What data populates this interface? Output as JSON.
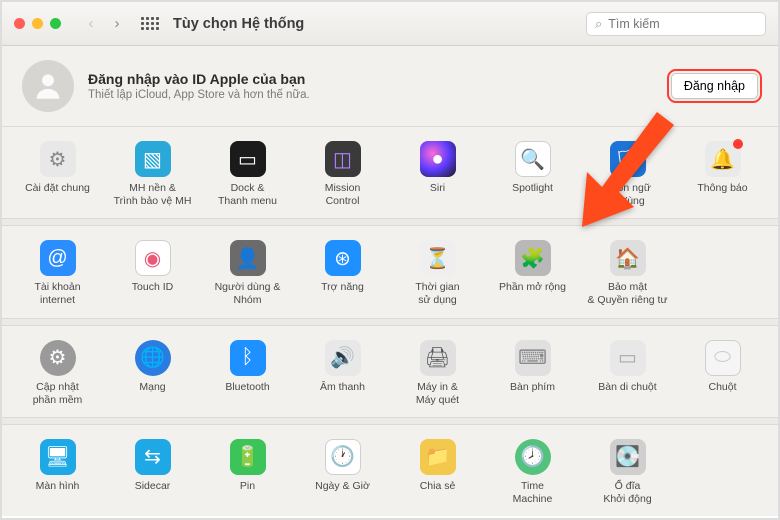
{
  "toolbar": {
    "title": "Tùy chọn Hệ thống",
    "search_placeholder": "Tìm kiếm"
  },
  "signin": {
    "heading": "Đăng nhập vào ID Apple của bạn",
    "sub": "Thiết lập iCloud, App Store và hơn thế nữa.",
    "button": "Đăng nhập"
  },
  "rows": [
    [
      {
        "id": "general",
        "label": "Cài đặt chung",
        "bg": "#e8e8e8",
        "glyph": "⚙",
        "fg": "#888"
      },
      {
        "id": "desktop",
        "label": "MH nền &\nTrình bảo vệ MH",
        "bg": "#2aa8d8",
        "glyph": "▧"
      },
      {
        "id": "dock",
        "label": "Dock &\nThanh menu",
        "bg": "#1b1b1b",
        "glyph": "▭"
      },
      {
        "id": "mission",
        "label": "Mission\nControl",
        "bg": "#3a3a3a",
        "glyph": "◫",
        "fg": "#b080ff"
      },
      {
        "id": "siri",
        "label": "Siri",
        "bg": "radial",
        "glyph": "●"
      },
      {
        "id": "spotlight",
        "label": "Spotlight",
        "bg": "#fff",
        "glyph": "🔍",
        "fg": "#4a4a4a",
        "border": true
      },
      {
        "id": "language",
        "label": "Ngôn ngữ\n& Vùng",
        "bg": "#1e74d6",
        "glyph": "🏳"
      },
      {
        "id": "notifications",
        "label": "Thông báo",
        "bg": "#eaeaea",
        "glyph": "🔔",
        "fg": "#555",
        "badge": true
      }
    ],
    [
      {
        "id": "internet",
        "label": "Tài khoản\ninternet",
        "bg": "#2b8eff",
        "glyph": "@"
      },
      {
        "id": "touchid",
        "label": "Touch ID",
        "bg": "#fff",
        "glyph": "◉",
        "fg": "#e85b78",
        "border": true
      },
      {
        "id": "users",
        "label": "Người dùng &\nNhóm",
        "bg": "#6b6b6b",
        "glyph": "👤"
      },
      {
        "id": "accessibility",
        "label": "Trợ năng",
        "bg": "#1e90ff",
        "glyph": "⊛"
      },
      {
        "id": "screentime",
        "label": "Thời gian\nsử dụng",
        "bg": "#efefef",
        "glyph": "⏳",
        "fg": "#6a5acd"
      },
      {
        "id": "extensions",
        "label": "Phần mở rộng",
        "bg": "#b8b8b8",
        "glyph": "🧩"
      },
      {
        "id": "security",
        "label": "Bảo mật\n& Quyền riêng tư",
        "bg": "#dedede",
        "glyph": "🏠",
        "fg": "#555"
      },
      null
    ],
    [
      {
        "id": "update",
        "label": "Cập nhật\nphần mềm",
        "bg": "#9a9a9a",
        "glyph": "⚙",
        "round": true
      },
      {
        "id": "network",
        "label": "Mạng",
        "bg": "#2a7de0",
        "glyph": "🌐",
        "round": true
      },
      {
        "id": "bluetooth",
        "label": "Bluetooth",
        "bg": "#1e90ff",
        "glyph": "ᛒ"
      },
      {
        "id": "sound",
        "label": "Âm thanh",
        "bg": "#e8e8e8",
        "glyph": "🔊",
        "fg": "#555"
      },
      {
        "id": "printers",
        "label": "Máy in &\nMáy quét",
        "bg": "#e0e0e0",
        "glyph": "🖨",
        "fg": "#555"
      },
      {
        "id": "keyboard",
        "label": "Bàn phím",
        "bg": "#e0e0e0",
        "glyph": "⌨",
        "fg": "#888"
      },
      {
        "id": "trackpad",
        "label": "Bàn di chuột",
        "bg": "#e8e8e8",
        "glyph": "▭",
        "fg": "#aaa"
      },
      {
        "id": "mouse",
        "label": "Chuột",
        "bg": "#f5f5f5",
        "glyph": "⬭",
        "fg": "#ccc",
        "border": true
      }
    ],
    [
      {
        "id": "displays",
        "label": "Màn hình",
        "bg": "#1ea8e6",
        "glyph": "🖥"
      },
      {
        "id": "sidecar",
        "label": "Sidecar",
        "bg": "#1ea8e6",
        "glyph": "⇆"
      },
      {
        "id": "battery",
        "label": "Pin",
        "bg": "#3cc45a",
        "glyph": "🔋"
      },
      {
        "id": "datetime",
        "label": "Ngày & Giờ",
        "bg": "#fff",
        "glyph": "🕐",
        "fg": "#3a7fd5",
        "border": true
      },
      {
        "id": "sharing",
        "label": "Chia sẻ",
        "bg": "#f2c94c",
        "glyph": "📁"
      },
      {
        "id": "timemachine",
        "label": "Time\nMachine",
        "bg": "#53c27d",
        "glyph": "🕗",
        "round": true
      },
      {
        "id": "startup",
        "label": "Ổ đĩa\nKhởi động",
        "bg": "#cfcfcf",
        "glyph": "💽",
        "fg": "#666"
      },
      null
    ]
  ]
}
